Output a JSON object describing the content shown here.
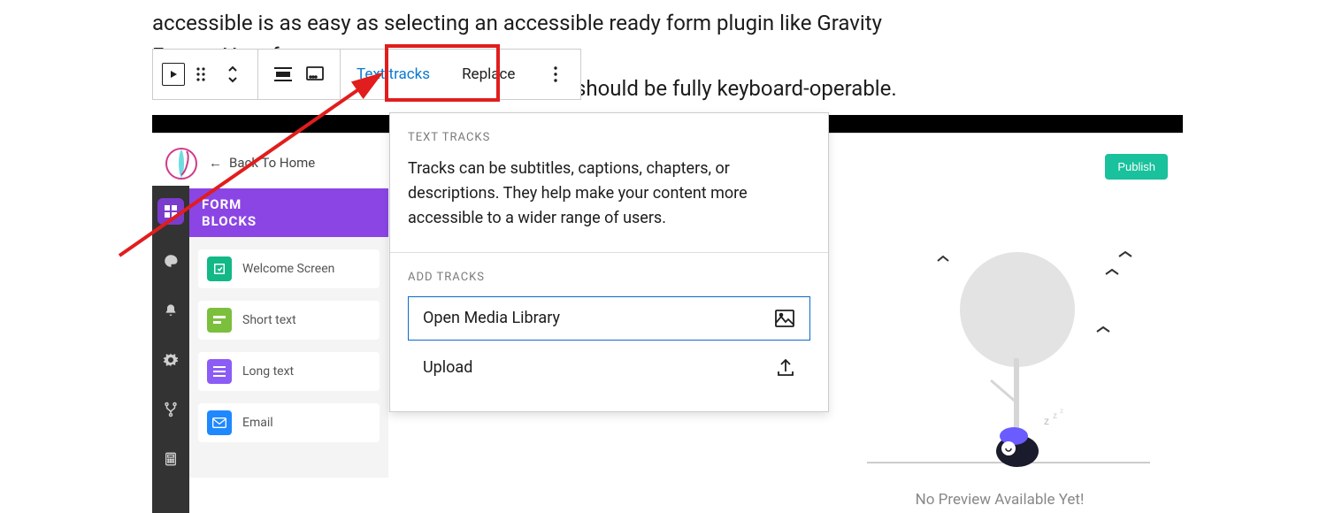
{
  "article": {
    "line1": "accessible is as easy as selecting an accessible ready form plugin like Gravity Forms. Your form",
    "line2": "should be fully keyboard-operable."
  },
  "toolbar": {
    "text_tracks_label": "Text tracks",
    "replace_label": "Replace"
  },
  "dropdown": {
    "section1_label": "TEXT TRACKS",
    "section1_desc": "Tracks can be subtitles, captions, chapters, or descriptions. They help make your content more accessible to a wider range of users.",
    "section2_label": "ADD TRACKS",
    "open_media_label": "Open Media Library",
    "upload_label": "Upload"
  },
  "header": {
    "back_label": "Back To Home",
    "publish_label": "Publish"
  },
  "panel": {
    "title_line1": "FORM",
    "title_line2": "BLOCKS",
    "items": [
      {
        "label": "Welcome Screen",
        "color": "teal"
      },
      {
        "label": "Short text",
        "color": "green"
      },
      {
        "label": "Long text",
        "color": "purple"
      },
      {
        "label": "Email",
        "color": "blue"
      }
    ]
  },
  "preview": {
    "caption": "No Preview Available Yet!"
  }
}
